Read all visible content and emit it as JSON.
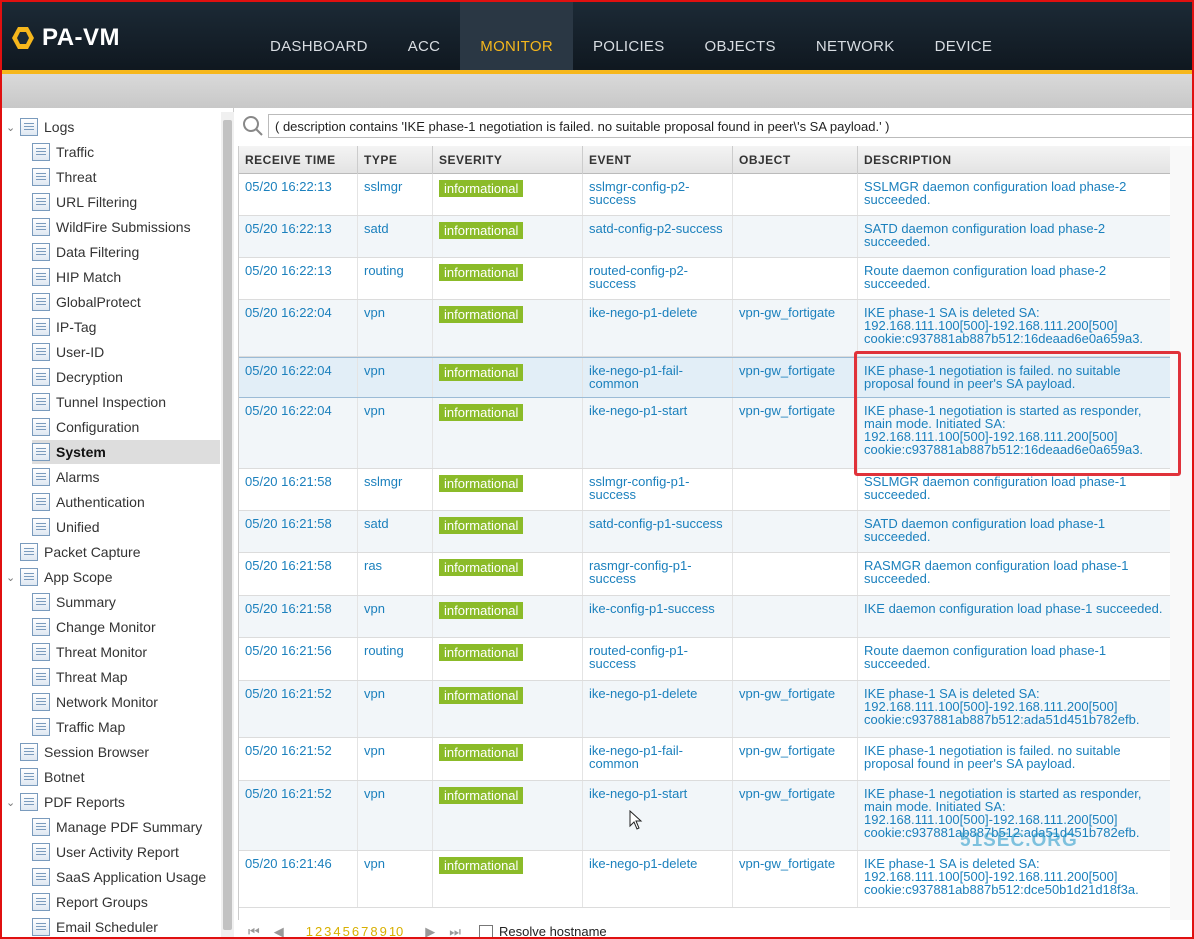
{
  "app": {
    "name": "PA-VM"
  },
  "nav": {
    "tabs": [
      "DASHBOARD",
      "ACC",
      "MONITOR",
      "POLICIES",
      "OBJECTS",
      "NETWORK",
      "DEVICE"
    ],
    "active": "MONITOR"
  },
  "search": {
    "query": "( description contains 'IKE phase-1 negotiation is failed. no suitable proposal found in peer\\'s SA payload.' )"
  },
  "sidebar": {
    "items": [
      {
        "label": "Logs",
        "level": 0,
        "exp": "v"
      },
      {
        "label": "Traffic",
        "level": 1
      },
      {
        "label": "Threat",
        "level": 1
      },
      {
        "label": "URL Filtering",
        "level": 1
      },
      {
        "label": "WildFire Submissions",
        "level": 1
      },
      {
        "label": "Data Filtering",
        "level": 1
      },
      {
        "label": "HIP Match",
        "level": 1
      },
      {
        "label": "GlobalProtect",
        "level": 1
      },
      {
        "label": "IP-Tag",
        "level": 1
      },
      {
        "label": "User-ID",
        "level": 1
      },
      {
        "label": "Decryption",
        "level": 1
      },
      {
        "label": "Tunnel Inspection",
        "level": 1
      },
      {
        "label": "Configuration",
        "level": 1
      },
      {
        "label": "System",
        "level": 1,
        "selected": true
      },
      {
        "label": "Alarms",
        "level": 1
      },
      {
        "label": "Authentication",
        "level": 1
      },
      {
        "label": "Unified",
        "level": 1
      },
      {
        "label": "Packet Capture",
        "level": 0
      },
      {
        "label": "App Scope",
        "level": 0,
        "exp": "v"
      },
      {
        "label": "Summary",
        "level": 1
      },
      {
        "label": "Change Monitor",
        "level": 1
      },
      {
        "label": "Threat Monitor",
        "level": 1
      },
      {
        "label": "Threat Map",
        "level": 1
      },
      {
        "label": "Network Monitor",
        "level": 1
      },
      {
        "label": "Traffic Map",
        "level": 1
      },
      {
        "label": "Session Browser",
        "level": 0
      },
      {
        "label": "Botnet",
        "level": 0
      },
      {
        "label": "PDF Reports",
        "level": 0,
        "exp": "v"
      },
      {
        "label": "Manage PDF Summary",
        "level": 1
      },
      {
        "label": "User Activity Report",
        "level": 1
      },
      {
        "label": "SaaS Application Usage",
        "level": 1
      },
      {
        "label": "Report Groups",
        "level": 1
      },
      {
        "label": "Email Scheduler",
        "level": 1
      }
    ]
  },
  "table": {
    "columns": [
      "RECEIVE TIME",
      "TYPE",
      "SEVERITY",
      "EVENT",
      "OBJECT",
      "DESCRIPTION"
    ],
    "rows": [
      {
        "time": "05/20 16:22:13",
        "type": "sslmgr",
        "severity": "informational",
        "event": "sslmgr-config-p2-success",
        "object": "",
        "description": "SSLMGR daemon configuration load phase-2 succeeded."
      },
      {
        "time": "05/20 16:22:13",
        "type": "satd",
        "severity": "informational",
        "event": "satd-config-p2-success",
        "object": "",
        "description": "SATD daemon configuration load phase-2 succeeded."
      },
      {
        "time": "05/20 16:22:13",
        "type": "routing",
        "severity": "informational",
        "event": "routed-config-p2-success",
        "object": "",
        "description": "Route daemon configuration load phase-2 succeeded."
      },
      {
        "time": "05/20 16:22:04",
        "type": "vpn",
        "severity": "informational",
        "event": "ike-nego-p1-delete",
        "object": "vpn-gw_fortigate",
        "description": "IKE phase-1 SA is deleted SA: 192.168.111.100[500]-192.168.111.200[500] cookie:c937881ab887b512:16deaad6e0a659a3."
      },
      {
        "time": "05/20 16:22:04",
        "type": "vpn",
        "severity": "informational",
        "event": "ike-nego-p1-fail-common",
        "object": "vpn-gw_fortigate",
        "description": "IKE phase-1 negotiation is failed. no suitable proposal found in peer's SA payload."
      },
      {
        "time": "05/20 16:22:04",
        "type": "vpn",
        "severity": "informational",
        "event": "ike-nego-p1-start",
        "object": "vpn-gw_fortigate",
        "description": "IKE phase-1 negotiation is started as responder, main mode. Initiated SA: 192.168.111.100[500]-192.168.111.200[500] cookie:c937881ab887b512:16deaad6e0a659a3."
      },
      {
        "time": "05/20 16:21:58",
        "type": "sslmgr",
        "severity": "informational",
        "event": "sslmgr-config-p1-success",
        "object": "",
        "description": "SSLMGR daemon configuration load phase-1 succeeded."
      },
      {
        "time": "05/20 16:21:58",
        "type": "satd",
        "severity": "informational",
        "event": "satd-config-p1-success",
        "object": "",
        "description": "SATD daemon configuration load phase-1 succeeded."
      },
      {
        "time": "05/20 16:21:58",
        "type": "ras",
        "severity": "informational",
        "event": "rasmgr-config-p1-success",
        "object": "",
        "description": "RASMGR daemon configuration load phase-1 succeeded."
      },
      {
        "time": "05/20 16:21:58",
        "type": "vpn",
        "severity": "informational",
        "event": "ike-config-p1-success",
        "object": "",
        "description": "IKE daemon configuration load phase-1 succeeded."
      },
      {
        "time": "05/20 16:21:56",
        "type": "routing",
        "severity": "informational",
        "event": "routed-config-p1-success",
        "object": "",
        "description": "Route daemon configuration load phase-1 succeeded."
      },
      {
        "time": "05/20 16:21:52",
        "type": "vpn",
        "severity": "informational",
        "event": "ike-nego-p1-delete",
        "object": "vpn-gw_fortigate",
        "description": "IKE phase-1 SA is deleted SA: 192.168.111.100[500]-192.168.111.200[500] cookie:c937881ab887b512:ada51d451b782efb."
      },
      {
        "time": "05/20 16:21:52",
        "type": "vpn",
        "severity": "informational",
        "event": "ike-nego-p1-fail-common",
        "object": "vpn-gw_fortigate",
        "description": "IKE phase-1 negotiation is failed. no suitable proposal found in peer's SA payload."
      },
      {
        "time": "05/20 16:21:52",
        "type": "vpn",
        "severity": "informational",
        "event": "ike-nego-p1-start",
        "object": "vpn-gw_fortigate",
        "description": "IKE phase-1 negotiation is started as responder, main mode. Initiated SA: 192.168.111.100[500]-192.168.111.200[500] cookie:c937881ab887b512:ada51d451b782efb."
      },
      {
        "time": "05/20 16:21:46",
        "type": "vpn",
        "severity": "informational",
        "event": "ike-nego-p1-delete",
        "object": "vpn-gw_fortigate",
        "description": "IKE phase-1 SA is deleted SA: 192.168.111.100[500]-192.168.111.200[500] cookie:c937881ab887b512:dce50b1d21d18f3a."
      }
    ]
  },
  "pager": {
    "pages": [
      "1",
      "2",
      "3",
      "4",
      "5",
      "6",
      "7",
      "8",
      "9",
      "10"
    ],
    "resolve_hostname": "Resolve hostname"
  },
  "watermark": "51SEC.ORG",
  "colors": {
    "accent": "#f6b71c",
    "severity_bg": "#8bbb29",
    "link": "#1b80bd",
    "highlight_box": "#e0323a"
  }
}
